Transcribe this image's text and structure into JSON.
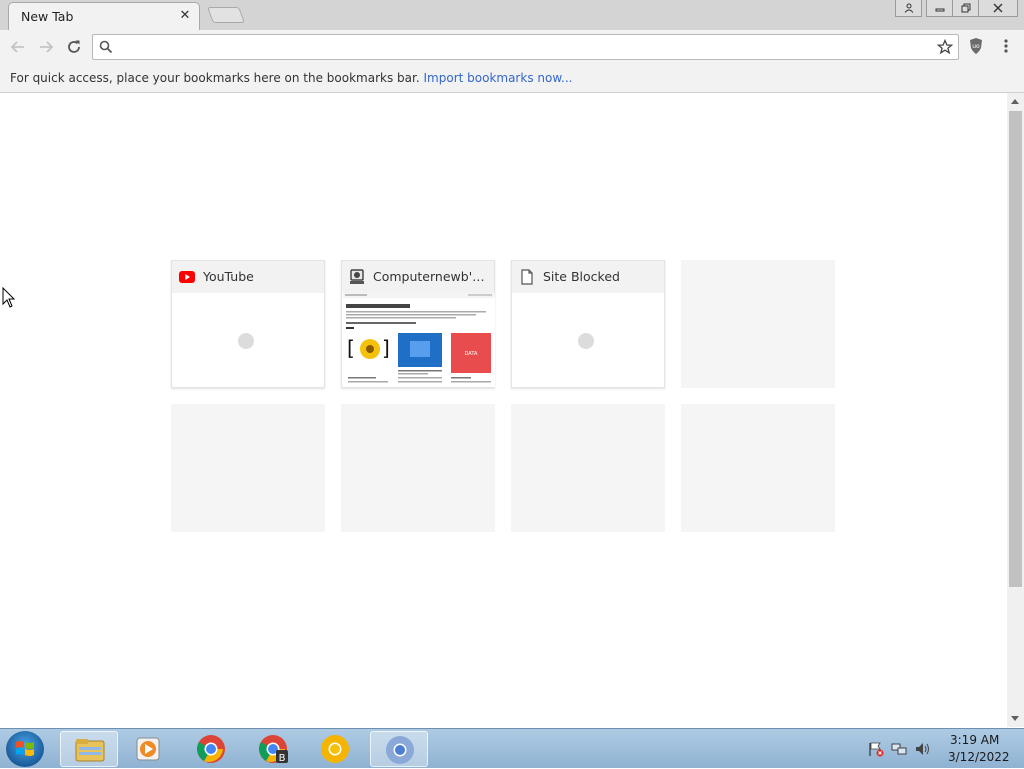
{
  "tab": {
    "title": "New Tab",
    "close_label": "✕"
  },
  "omnibox": {
    "value": "",
    "placeholder": ""
  },
  "bookmarks_bar": {
    "prompt": "For quick access, place your bookmarks here on the bookmarks bar.",
    "import_link": "Import bookmarks now..."
  },
  "tiles": [
    {
      "title": "YouTube"
    },
    {
      "title": "Computernewb's Int..."
    },
    {
      "title": "Site Blocked"
    }
  ],
  "thumbnail": {
    "heading": "Computernewb.com Homepage",
    "badge_text": "DATA"
  },
  "taskbar": {
    "time": "3:19 AM",
    "date": "3/12/2022"
  },
  "colors": {
    "youtube_red": "#ff0000",
    "link_blue": "#3366cc",
    "chrome_red": "#db4437",
    "chrome_green": "#0f9d58",
    "chrome_yellow": "#f4b400",
    "chrome_blue": "#4285f4"
  },
  "icons": {
    "tile_1": "youtube-icon",
    "tile_2": "computer-icon",
    "tile_3": "page-icon"
  }
}
